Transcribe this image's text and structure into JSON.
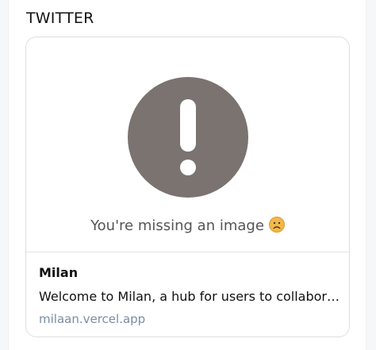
{
  "section": {
    "title": "TWITTER"
  },
  "card": {
    "media": {
      "icon_name": "exclamation-circle-icon",
      "icon_color": "#7a736f",
      "missing_image_text": "You're missing an image",
      "emoji": "frowning-face-emoji"
    },
    "title": "Milan",
    "description": "Welcome to Milan, a hub for users to collaborate...",
    "link_text": "milaan.vercel.app"
  }
}
